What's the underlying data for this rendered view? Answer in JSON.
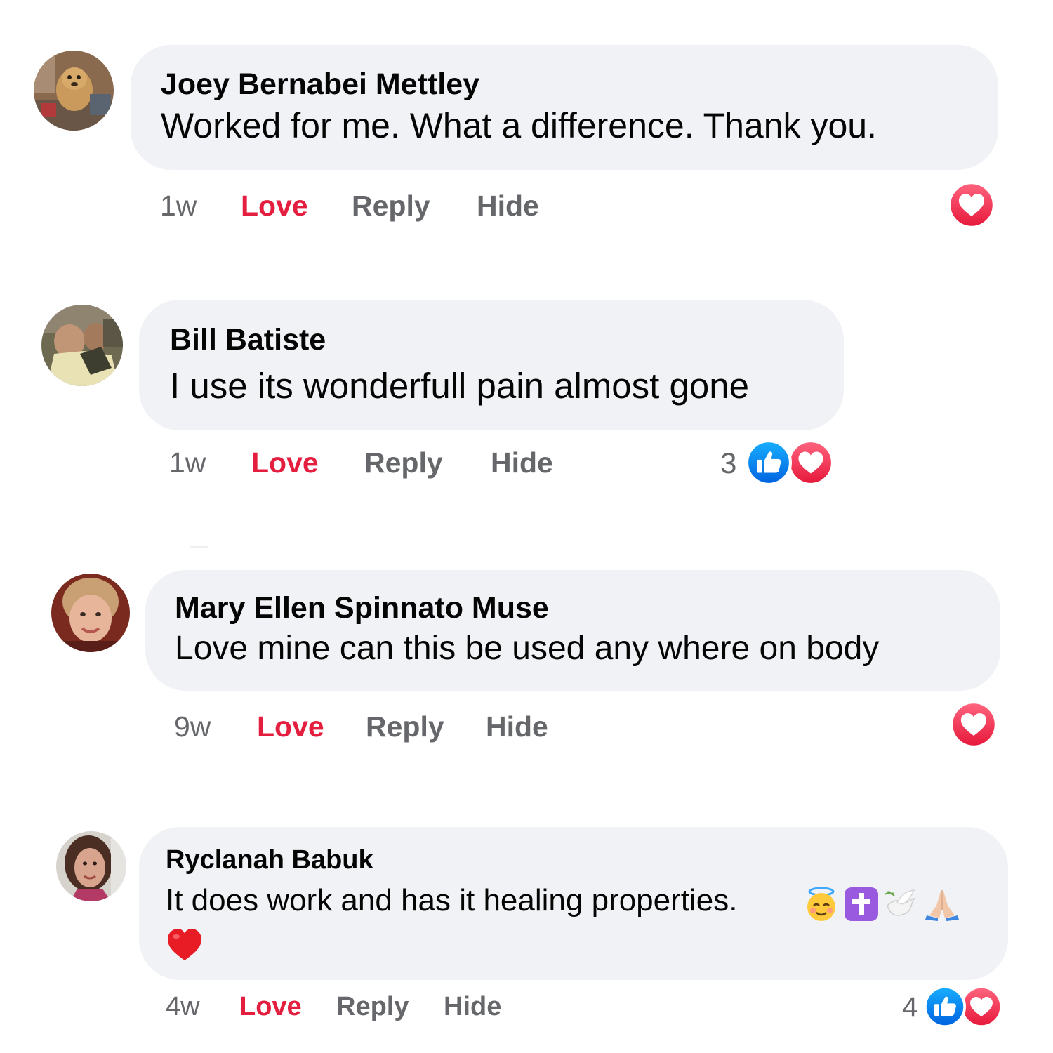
{
  "comments": [
    {
      "author": "Joey Bernabei Mettley",
      "text": "Worked for me. What a difference. Thank you.",
      "time": "1w",
      "love_label": "Love",
      "reply_label": "Reply",
      "hide_label": "Hide",
      "reaction_count": "",
      "reactions": [
        "love"
      ]
    },
    {
      "author": "Bill Batiste",
      "text": "I use its wonderfull pain almost gone",
      "time": "1w",
      "love_label": "Love",
      "reply_label": "Reply",
      "hide_label": "Hide",
      "reaction_count": "3",
      "reactions": [
        "like",
        "love"
      ]
    },
    {
      "author": "Mary Ellen Spinnato Muse",
      "text": "Love mine can this be used any where on body",
      "time": "9w",
      "love_label": "Love",
      "reply_label": "Reply",
      "hide_label": "Hide",
      "reaction_count": "",
      "reactions": [
        "love"
      ]
    },
    {
      "author": "Ryclanah Babuk",
      "text": "It does work and has it healing properties.",
      "emojis": [
        "smiling-face-with-halo",
        "latin-cross",
        "dove",
        "folded-hands",
        "red-heart"
      ],
      "time": "4w",
      "love_label": "Love",
      "reply_label": "Reply",
      "hide_label": "Hide",
      "reaction_count": "4",
      "reactions": [
        "like",
        "love"
      ]
    }
  ],
  "colors": {
    "bubble": "#f0f2f5",
    "love_red": "#e41e3f",
    "like_blue": "#1877f2",
    "meta_gray": "#65676b",
    "text": "#050505"
  }
}
